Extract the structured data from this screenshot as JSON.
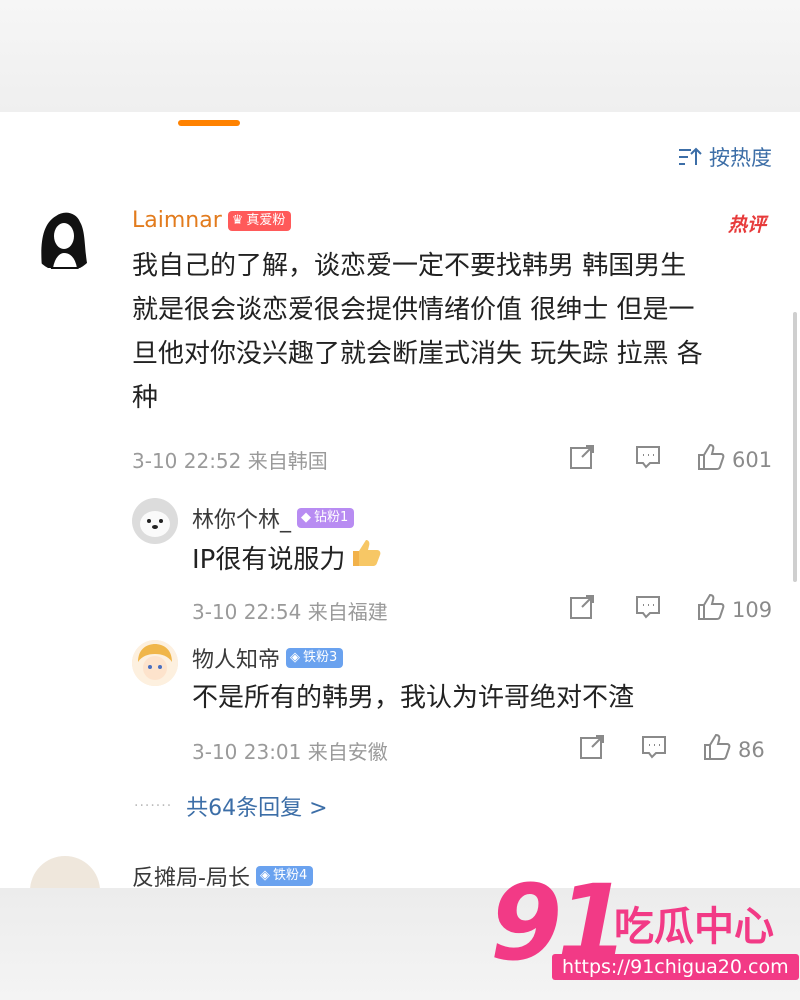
{
  "sort": {
    "label": "按热度"
  },
  "comments": [
    {
      "user": "Laimnar",
      "badge": "真爱粉",
      "tag": "热评",
      "lines": [
        "我自己的了解，谈恋爱一定不要找韩男 韩国男生",
        "就是很会谈恋爱很会提供情绪价值 很绅士 但是一",
        "旦他对你没兴趣了就会断崖式消失 玩失踪 拉黑 各",
        "种"
      ],
      "time": "3-10 22:52 来自韩国",
      "likes": "601"
    }
  ],
  "replies": [
    {
      "user": "林你个林_",
      "badge": "钻粉1",
      "text": "IP很有说服力",
      "time": "3-10 22:54 来自福建",
      "likes": "109"
    },
    {
      "user": "物人知帝",
      "badge": "铁粉3",
      "text": "不是所有的韩男，我认为许哥绝对不渣",
      "time": "3-10 23:01 来自安徽",
      "likes": "86"
    }
  ],
  "more_replies": {
    "dots": "·······",
    "label": "共64条回复 >"
  },
  "next_comment": {
    "user": "反摊局-局长",
    "badge": "铁粉4"
  },
  "watermark": {
    "number": "91",
    "text": "吃瓜中心",
    "url": "https://91chigua20.com"
  },
  "colors": {
    "accent": "#ff8200",
    "link": "#3c6ea7",
    "hot": "#e73b3b",
    "watermark": "#f23a86"
  }
}
